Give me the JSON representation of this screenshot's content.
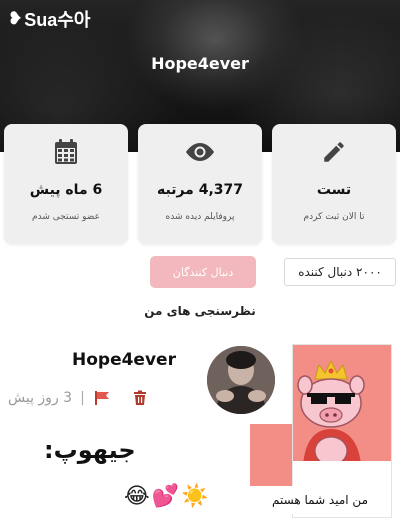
{
  "header": {
    "logo_text": "Sua수아",
    "logo_icon": "heart-icon",
    "username": "Hope4ever"
  },
  "stats": [
    {
      "icon": "pencil-icon",
      "value": "تست",
      "label": "تا الان ثبت کردم"
    },
    {
      "icon": "eye-icon",
      "value": "4,377 مرتبه",
      "label": "پروفایلم دیده شده"
    },
    {
      "icon": "calendar-icon",
      "value": "6 ماه پیش",
      "label": "عضو تستجی شدم"
    }
  ],
  "followers": {
    "count_text": "۲۰۰۰ دنبال کننده",
    "button_label": "دنبال کنندگان"
  },
  "section_title": "نظرسنجی های من",
  "post": {
    "author": "Hope4ever",
    "time": "3 روز پیش",
    "separator": "|",
    "caption": "جیهوپ:",
    "emojis": "😂💕☀️",
    "poll_option": "من امید شما هستم"
  },
  "colors": {
    "accent_pink": "#f2b8bd",
    "poll_bg": "#f28e86",
    "action_red": "#c0392b"
  }
}
